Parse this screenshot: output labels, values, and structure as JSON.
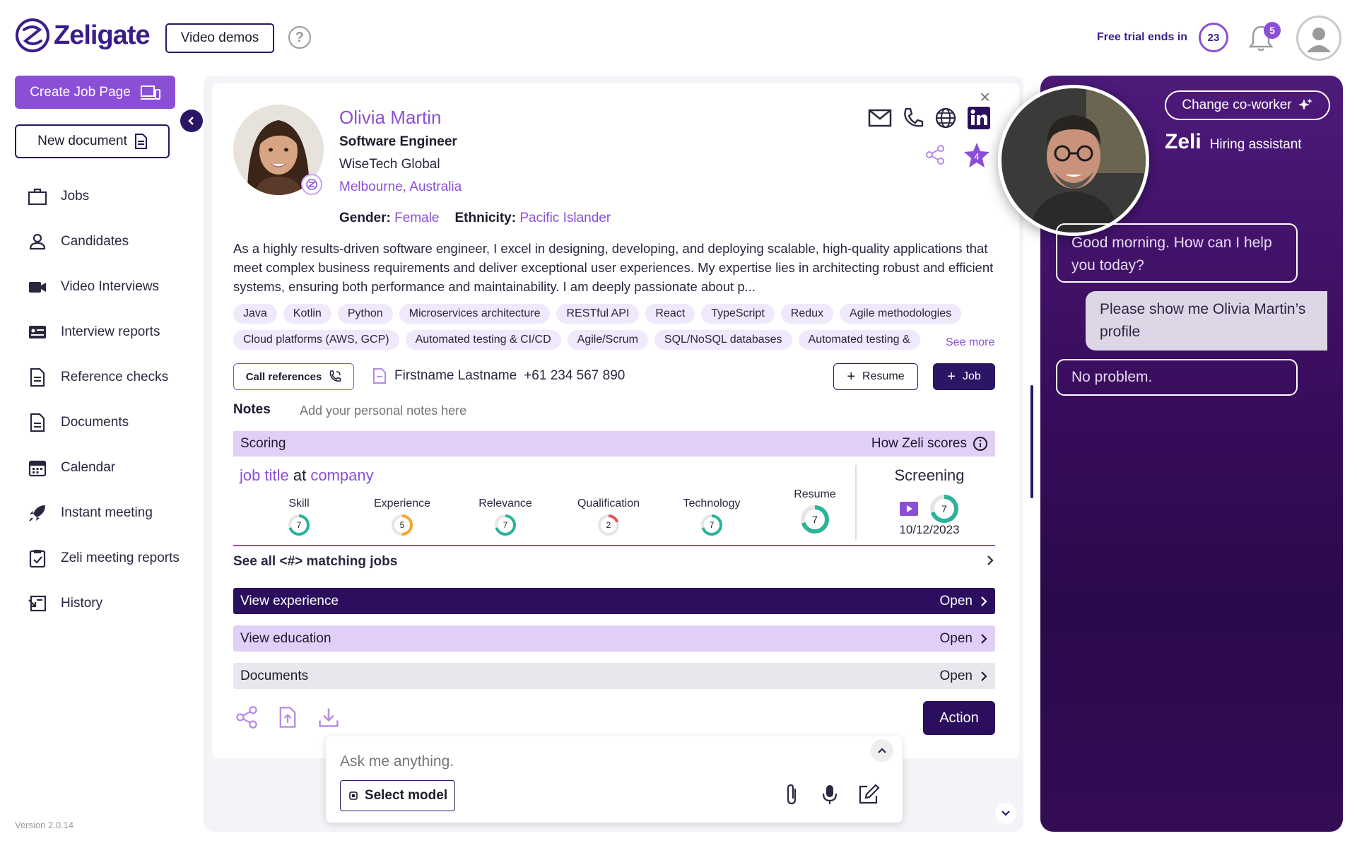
{
  "header": {
    "logo_text": "Zeligate",
    "video_demos": "Video demos",
    "help": "?",
    "trial_label": "Free trial ends in",
    "trial_days": "23",
    "notifications": "5"
  },
  "sidebar": {
    "create_job": "Create Job Page",
    "new_document": "New document",
    "items": [
      {
        "label": "Jobs",
        "icon": "briefcase-icon"
      },
      {
        "label": "Candidates",
        "icon": "person-icon"
      },
      {
        "label": "Video Interviews",
        "icon": "video-icon"
      },
      {
        "label": "Interview reports",
        "icon": "report-card-icon"
      },
      {
        "label": "Reference checks",
        "icon": "document-check-icon"
      },
      {
        "label": "Documents",
        "icon": "document-icon"
      },
      {
        "label": "Calendar",
        "icon": "calendar-icon"
      },
      {
        "label": "Instant meeting",
        "icon": "rocket-icon"
      },
      {
        "label": "Zeli meeting reports",
        "icon": "clipboard-check-icon"
      },
      {
        "label": "History",
        "icon": "history-icon"
      }
    ],
    "version": "Version 2.0.14"
  },
  "candidate": {
    "name": "Olivia Martin",
    "role": "Software Engineer",
    "company": "WiseTech Global",
    "location": "Melbourne, Australia",
    "gender_label": "Gender:",
    "gender": "Female",
    "ethnicity_label": "Ethnicity:",
    "ethnicity": "Pacific Islander",
    "star_count": "4",
    "bio": "As a highly results-driven software engineer, I excel in designing, developing, and deploying scalable, high-quality applications that meet complex business requirements and deliver exceptional user experiences. My expertise lies in architecting robust and efficient systems, ensuring both performance and maintainability. I am deeply passionate about p...",
    "tags_row1": [
      "Java",
      "Kotlin",
      "Python",
      "Microservices architecture",
      "RESTful API",
      "React",
      "TypeScript",
      "Redux",
      "Agile methodologies"
    ],
    "tags_row2": [
      "Cloud platforms (AWS, GCP)",
      "Automated testing & CI/CD",
      "Agile/Scrum",
      "SQL/NoSQL databases",
      "Automated testing &"
    ],
    "see_more": "See more",
    "call_references": "Call references",
    "ref_name": "Firstname Lastname",
    "ref_phone": "+61 234 567 890",
    "resume_btn": "Resume",
    "job_btn": "Job",
    "notes_label": "Notes",
    "notes_placeholder": "Add your personal notes here"
  },
  "scoring": {
    "title": "Scoring",
    "how": "How Zeli scores",
    "job_title": "job title",
    "at": "at",
    "company": "company",
    "metrics": [
      {
        "label": "Skill",
        "value": "7",
        "color": "#2bb39a"
      },
      {
        "label": "Experience",
        "value": "5",
        "color": "#f0a830"
      },
      {
        "label": "Relevance",
        "value": "7",
        "color": "#2bb39a"
      },
      {
        "label": "Qualification",
        "value": "2",
        "color": "#e8505b"
      },
      {
        "label": "Technology",
        "value": "7",
        "color": "#2bb39a"
      },
      {
        "label": "Resume",
        "value": "7",
        "color": "#2bb39a"
      }
    ],
    "screening_label": "Screening",
    "screening_value": "7",
    "screening_date": "10/12/2023",
    "matching_jobs": "See all <#> matching jobs"
  },
  "sections": {
    "experience": "View experience",
    "education": "View education",
    "documents": "Documents",
    "open": "Open"
  },
  "actions": {
    "action": "Action"
  },
  "chat": {
    "placeholder": "Ask me anything.",
    "select_model": "Select model"
  },
  "zeli": {
    "change_coworker": "Change co-worker",
    "name": "Zeli",
    "role": "Hiring assistant",
    "messages": [
      "Good morning. How can I help you today?",
      "Please show me Olivia Martin’s profile",
      "No problem."
    ]
  },
  "colors": {
    "accent": "#8b4fd6",
    "dark": "#2b0f5e",
    "light_purple": "#e2cff7"
  }
}
